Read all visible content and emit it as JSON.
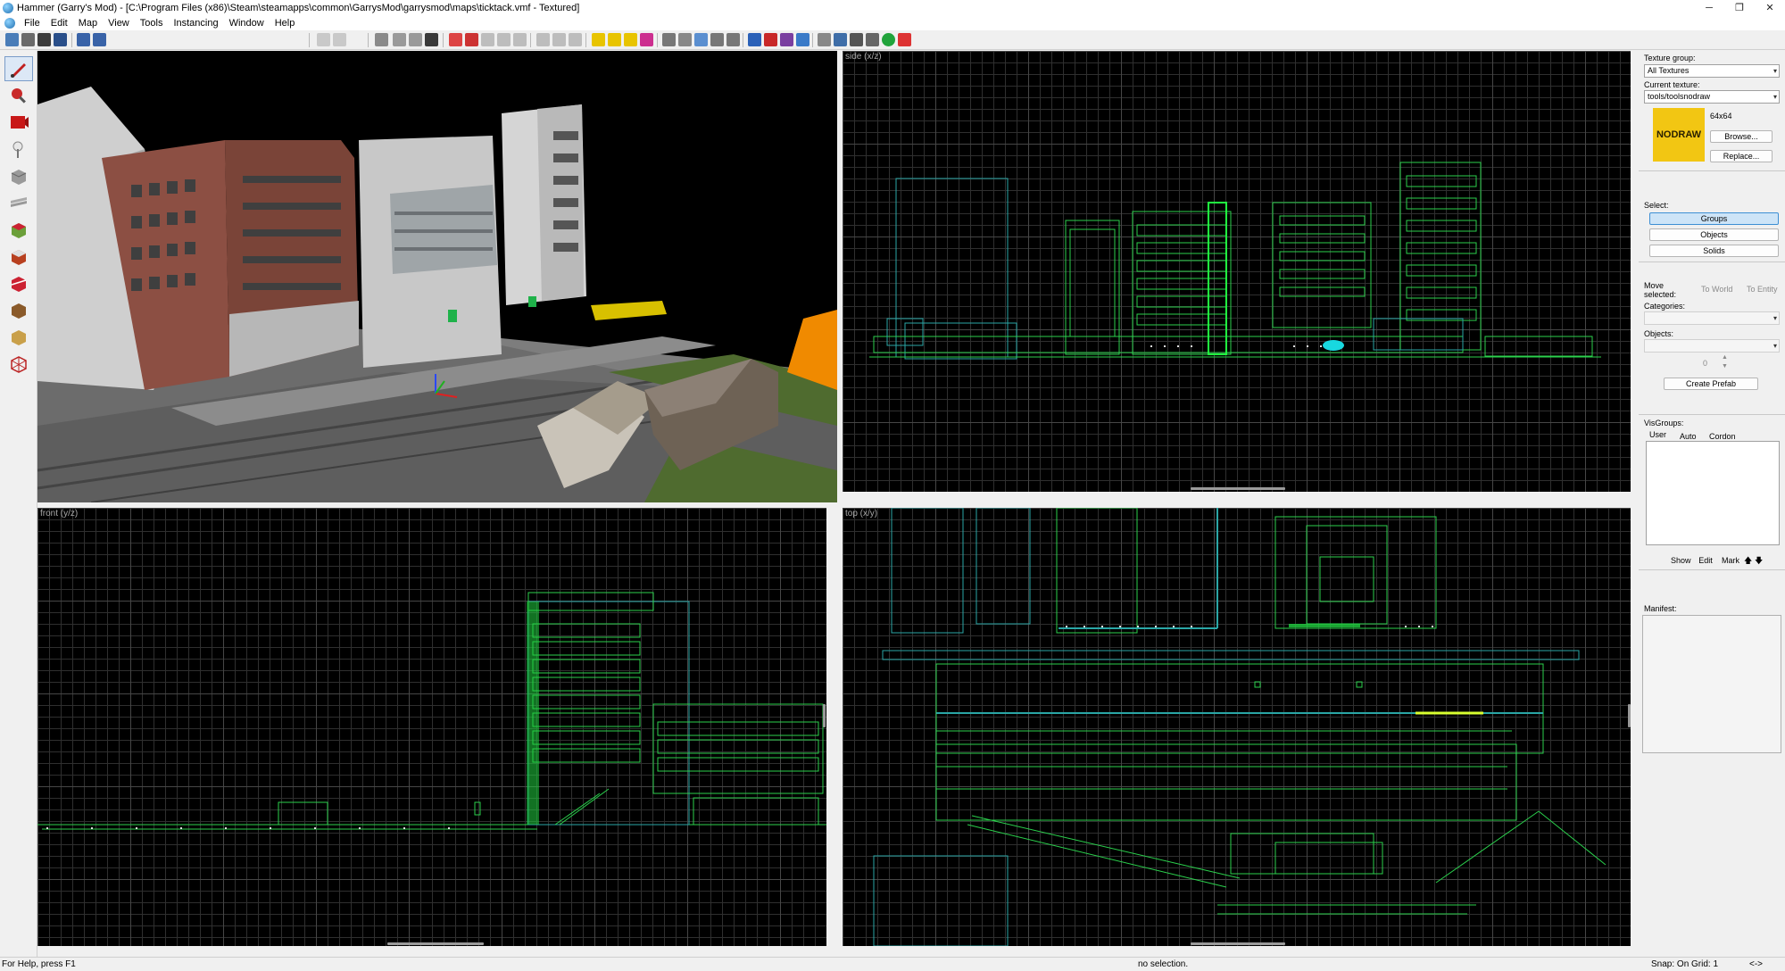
{
  "window": {
    "title": "Hammer (Garry's Mod) - [C:\\Program Files (x86)\\Steam\\steamapps\\common\\GarrysMod\\garrysmod\\maps\\ticktack.vmf - Textured]",
    "minimize_glyph": "─",
    "restore_glyph": "❐",
    "close_glyph": "✕"
  },
  "menu": {
    "items": [
      "File",
      "Edit",
      "Map",
      "View",
      "Tools",
      "Instancing",
      "Window",
      "Help"
    ]
  },
  "viewports": {
    "side_label": "side (x/z)",
    "front_label": "front (y/z)",
    "top_label": "top (x/y)"
  },
  "texture_panel": {
    "texture_group_label": "Texture group:",
    "texture_group_value": "All Textures",
    "current_texture_label": "Current texture:",
    "current_texture_value": "tools/toolsnodraw",
    "preview_text": "NODRAW",
    "texture_size": "64x64",
    "browse_label": "Browse...",
    "replace_label": "Replace...",
    "preview_color": "#f2c613"
  },
  "select_panel": {
    "label": "Select:",
    "groups_label": "Groups",
    "objects_label": "Objects",
    "solids_label": "Solids"
  },
  "move_panel": {
    "label_line1": "Move",
    "label_line2": "selected:",
    "to_world_label": "To World",
    "to_entity_label": "To Entity",
    "categories_label": "Categories:",
    "objects_label": "Objects:",
    "spin_value": "0",
    "create_prefab_label": "Create Prefab"
  },
  "visgroups": {
    "label": "VisGroups:",
    "tabs": [
      "User",
      "Auto",
      "Cordon"
    ],
    "show_label": "Show",
    "edit_label": "Edit",
    "mark_label": "Mark",
    "up_glyph": "🡅",
    "down_glyph": "🡇"
  },
  "manifest": {
    "label": "Manifest:"
  },
  "status": {
    "help": "For Help, press F1",
    "selection": "no selection.",
    "snap": "Snap: On Grid: 1",
    "arrows": "<->"
  }
}
